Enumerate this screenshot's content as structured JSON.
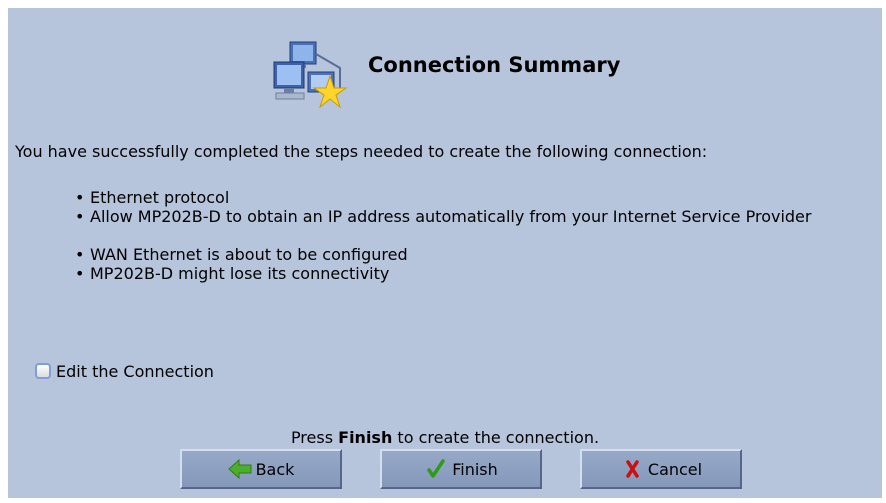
{
  "page": {
    "title": "Connection Summary",
    "intro": "You have successfully completed the steps needed to create the following connection:",
    "items": [
      "Ethernet protocol",
      "Allow MP202B-D to obtain an IP address automatically from your Internet Service Provider",
      "WAN Ethernet is about to be configured",
      "MP202B-D might lose its connectivity"
    ],
    "bullet": "•"
  },
  "edit": {
    "label": "Edit the Connection",
    "checked": false
  },
  "footer": {
    "note_prefix": "Press ",
    "note_bold": "Finish",
    "note_suffix": " to create the connection."
  },
  "buttons": {
    "back": "Back",
    "finish": "Finish",
    "cancel": "Cancel"
  },
  "colors": {
    "panel": "#b7c5dc",
    "button": "#8fa1c3",
    "back_arrow": "#4cae2a",
    "finish_check": "#2f9a16",
    "cancel_x": "#cc1010"
  },
  "icons": {
    "header": "network-computers-star-icon",
    "back": "arrow-left-icon",
    "finish": "checkmark-icon",
    "cancel": "x-icon"
  }
}
